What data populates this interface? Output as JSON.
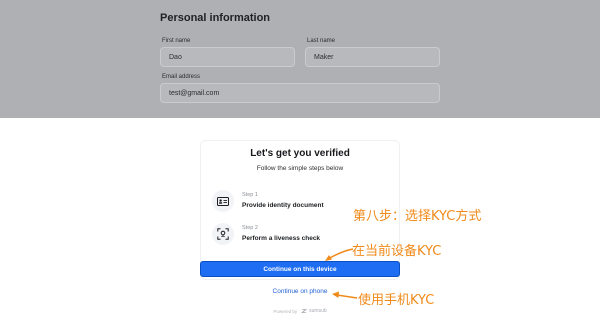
{
  "form": {
    "section_title": "Personal information",
    "first_name": {
      "label": "First name",
      "value": "Dao"
    },
    "last_name": {
      "label": "Last name",
      "value": "Maker"
    },
    "email": {
      "label": "Email address",
      "value": "test@gmail.com"
    }
  },
  "verify": {
    "title": "Let's get you verified",
    "subtitle": "Follow the simple steps below",
    "steps": [
      {
        "step_label": "Step 1",
        "title": "Provide identity document",
        "icon": "id-card-icon"
      },
      {
        "step_label": "Step 2",
        "title": "Perform a liveness check",
        "icon": "face-scan-icon"
      }
    ],
    "primary_button": "Continue on this device",
    "secondary_link": "Continue on phone",
    "powered_by": "Powered by",
    "brand": "sumsub"
  },
  "annotations": {
    "step8": "第八步：选择KYC方式",
    "this_device": "在当前设备KYC",
    "phone": "使用手机KYC",
    "color": "#f08a1a"
  },
  "colors": {
    "primary": "#1f6df2",
    "link": "#1f5fd6",
    "overlay": "#aeb0b3"
  }
}
